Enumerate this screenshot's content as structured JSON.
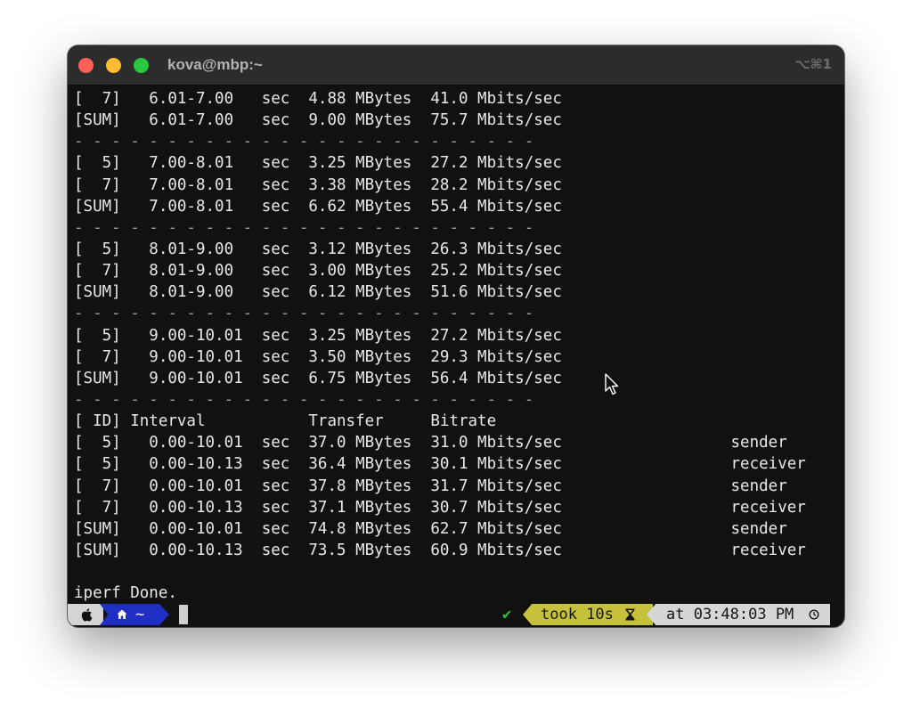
{
  "window": {
    "title": "kova@mbp:~",
    "shortcut": "⌥⌘1"
  },
  "terminal": {
    "lines": [
      {
        "text": "[  7]   6.01-7.00   sec  4.88 MBytes  41.0 Mbits/sec",
        "type": "out"
      },
      {
        "text": "[SUM]   6.01-7.00   sec  9.00 MBytes  75.7 Mbits/sec",
        "type": "out"
      },
      {
        "text": "- - - - - - - - - - - - - - - - - - - - - - - - -",
        "type": "sep"
      },
      {
        "text": "[  5]   7.00-8.01   sec  3.25 MBytes  27.2 Mbits/sec",
        "type": "out"
      },
      {
        "text": "[  7]   7.00-8.01   sec  3.38 MBytes  28.2 Mbits/sec",
        "type": "out"
      },
      {
        "text": "[SUM]   7.00-8.01   sec  6.62 MBytes  55.4 Mbits/sec",
        "type": "out"
      },
      {
        "text": "- - - - - - - - - - - - - - - - - - - - - - - - -",
        "type": "sep"
      },
      {
        "text": "[  5]   8.01-9.00   sec  3.12 MBytes  26.3 Mbits/sec",
        "type": "out"
      },
      {
        "text": "[  7]   8.01-9.00   sec  3.00 MBytes  25.2 Mbits/sec",
        "type": "out"
      },
      {
        "text": "[SUM]   8.01-9.00   sec  6.12 MBytes  51.6 Mbits/sec",
        "type": "out"
      },
      {
        "text": "- - - - - - - - - - - - - - - - - - - - - - - - -",
        "type": "sep"
      },
      {
        "text": "[  5]   9.00-10.01  sec  3.25 MBytes  27.2 Mbits/sec",
        "type": "out"
      },
      {
        "text": "[  7]   9.00-10.01  sec  3.50 MBytes  29.3 Mbits/sec",
        "type": "out"
      },
      {
        "text": "[SUM]   9.00-10.01  sec  6.75 MBytes  56.4 Mbits/sec",
        "type": "out"
      },
      {
        "text": "- - - - - - - - - - - - - - - - - - - - - - - - -",
        "type": "sep"
      },
      {
        "text": "[ ID] Interval           Transfer     Bitrate",
        "type": "out"
      },
      {
        "text": "[  5]   0.00-10.01  sec  37.0 MBytes  31.0 Mbits/sec                  sender",
        "type": "out"
      },
      {
        "text": "[  5]   0.00-10.13  sec  36.4 MBytes  30.1 Mbits/sec                  receiver",
        "type": "out"
      },
      {
        "text": "[  7]   0.00-10.01  sec  37.8 MBytes  31.7 Mbits/sec                  sender",
        "type": "out"
      },
      {
        "text": "[  7]   0.00-10.13  sec  37.1 MBytes  30.7 Mbits/sec                  receiver",
        "type": "out"
      },
      {
        "text": "[SUM]   0.00-10.01  sec  74.8 MBytes  62.7 Mbits/sec                  sender",
        "type": "out"
      },
      {
        "text": "[SUM]   0.00-10.13  sec  73.5 MBytes  60.9 Mbits/sec                  receiver",
        "type": "out"
      },
      {
        "text": "",
        "type": "blank"
      },
      {
        "text": "iperf Done.",
        "type": "out"
      }
    ]
  },
  "prompt": {
    "os_icon": "apple-icon",
    "dir_icon": "home-icon",
    "home_symbol": "⌂",
    "apple_symbol": "",
    "dir": "~",
    "status_check": "✔",
    "took_text": "took 10s",
    "hourglass_symbol": "⧗",
    "time_text": "at 03:48:03 PM",
    "clock_symbol": "◷"
  },
  "colors": {
    "terminal_bg": "#111111",
    "titlebar_bg": "#2c2c2c",
    "dir_segment": "#1f2fc4",
    "took_segment": "#c6c13a",
    "time_segment": "#d6d6d6",
    "check": "#31c23a"
  }
}
